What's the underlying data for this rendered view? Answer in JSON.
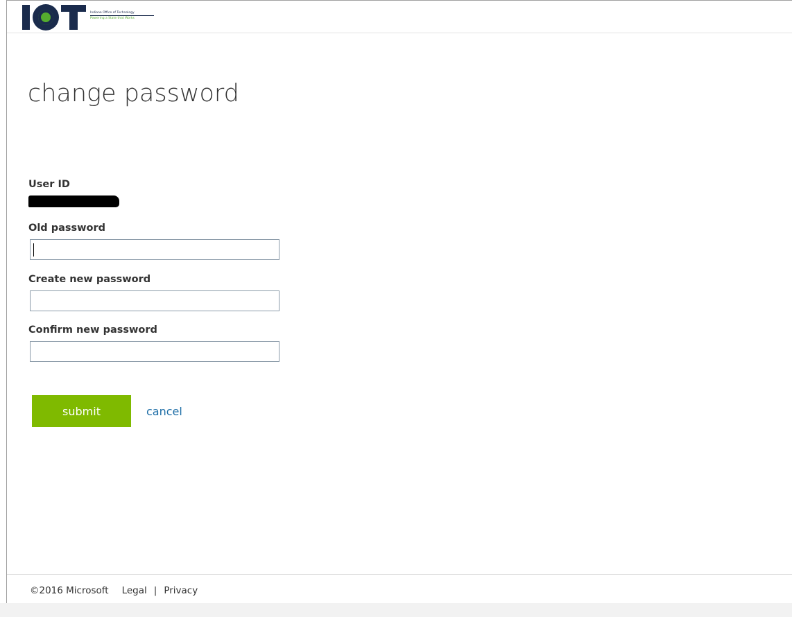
{
  "header": {
    "logo_letters": "IOT",
    "logo_line1": "Indiana Office of Technology",
    "logo_line2": "Powering a State that Works"
  },
  "page": {
    "title": "change password"
  },
  "form": {
    "user_id_label": "User ID",
    "old_password_label": "Old password",
    "old_password_value": "",
    "new_password_label": "Create new password",
    "new_password_value": "",
    "confirm_password_label": "Confirm new password",
    "confirm_password_value": "",
    "submit_label": "submit",
    "cancel_label": "cancel"
  },
  "footer": {
    "copyright": "©2016 Microsoft",
    "legal": "Legal",
    "separator": "|",
    "privacy": "Privacy"
  },
  "colors": {
    "brand_navy": "#1a2b4c",
    "brand_green": "#55ac2e",
    "submit_green": "#7fba00",
    "link_blue": "#1e6ea7"
  }
}
